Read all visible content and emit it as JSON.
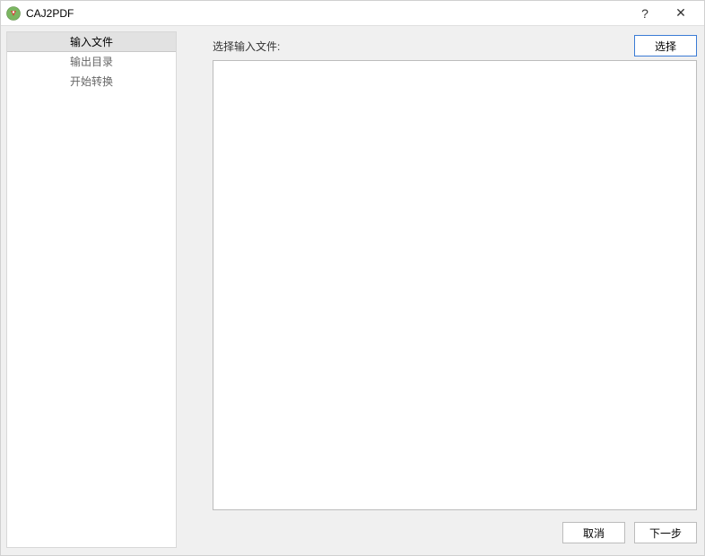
{
  "titlebar": {
    "title": "CAJ2PDF",
    "help_symbol": "?",
    "close_symbol": "✕"
  },
  "sidebar": {
    "items": [
      {
        "label": "输入文件",
        "selected": true
      },
      {
        "label": "输出目录",
        "selected": false
      },
      {
        "label": "开始转换",
        "selected": false
      }
    ]
  },
  "main": {
    "prompt_label": "选择输入文件:",
    "select_button": "选择"
  },
  "footer": {
    "cancel": "取消",
    "next": "下一步"
  }
}
